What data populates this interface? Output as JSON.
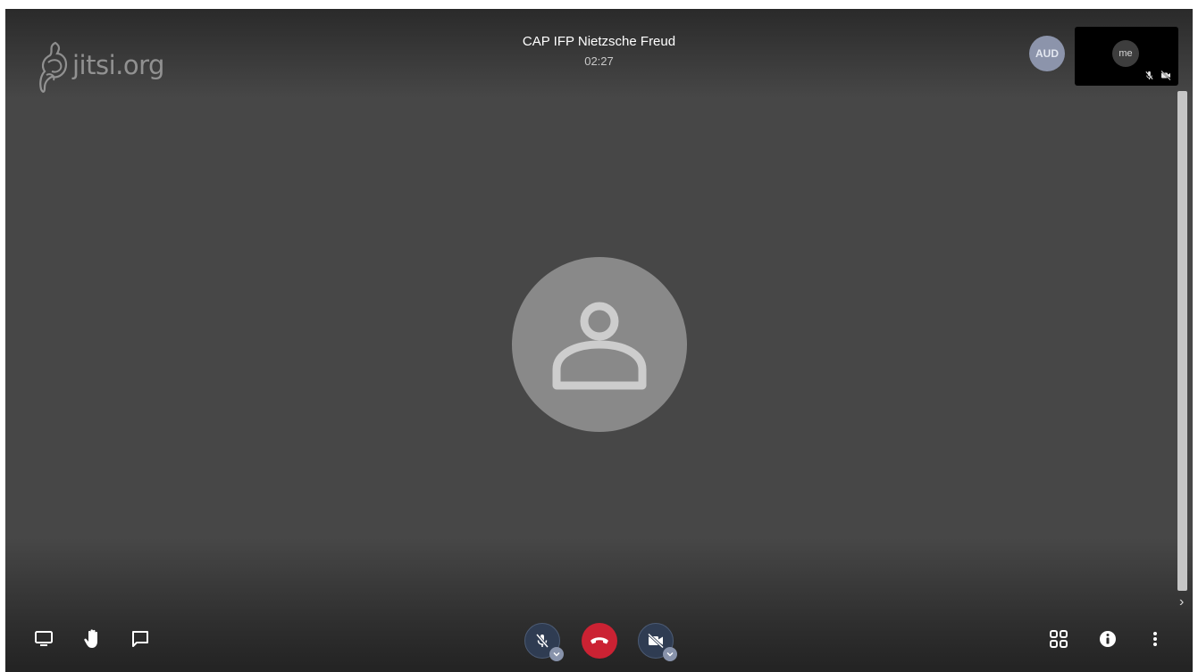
{
  "watermark": {
    "text": "jitsi.org",
    "icon": "jitsi-logo-icon"
  },
  "header": {
    "subject": "CAP IFP Nietzsche Freud",
    "timer": "02:27"
  },
  "participants": {
    "remote": {
      "initials": "AUD",
      "color": "#8c94ab"
    },
    "local": {
      "label": "me",
      "audio_muted": true,
      "video_muted": true
    }
  },
  "toolbar": {
    "left": [
      {
        "name": "screenshare",
        "icon": "monitor-icon"
      },
      {
        "name": "raise-hand",
        "icon": "hand-icon"
      },
      {
        "name": "chat",
        "icon": "chat-bubble-icon"
      }
    ],
    "center": [
      {
        "name": "microphone",
        "icon": "mic-off-icon",
        "state": "muted"
      },
      {
        "name": "hangup",
        "icon": "phone-hangup-icon",
        "color": "#cb2233"
      },
      {
        "name": "camera",
        "icon": "camera-off-icon",
        "state": "off"
      }
    ],
    "right": [
      {
        "name": "tile-view",
        "icon": "tile-grid-icon"
      },
      {
        "name": "info",
        "icon": "info-icon"
      },
      {
        "name": "more",
        "icon": "more-vertical-icon"
      }
    ]
  },
  "colors": {
    "stage": "#474747",
    "hangup": "#cb2233",
    "button_dark": "#2f3c52"
  }
}
